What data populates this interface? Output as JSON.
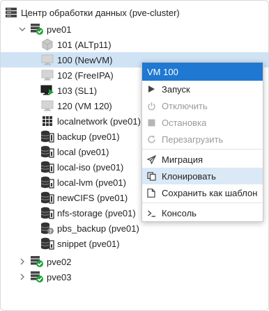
{
  "tree": {
    "datacenter": "Центр обработки данных (pve-cluster)",
    "node1": "pve01",
    "vms": [
      {
        "label": "101 (ALTp11)"
      },
      {
        "label": "100 (NewVM)"
      },
      {
        "label": "102 (FreeIPA)"
      },
      {
        "label": "103 (SL1)"
      },
      {
        "label": "120 (VM 120)"
      }
    ],
    "network": "localnetwork (pve01)",
    "storages": [
      {
        "label": "backup (pve01)"
      },
      {
        "label": "local (pve01)"
      },
      {
        "label": "local-iso (pve01)"
      },
      {
        "label": "local-lvm (pve01)"
      },
      {
        "label": "newCIFS (pve01)"
      },
      {
        "label": "nfs-storage (pve01)"
      },
      {
        "label": "pbs_backup (pve01)"
      },
      {
        "label": "snippet (pve01)"
      }
    ],
    "node2": "pve02",
    "node3": "pve03"
  },
  "menu": {
    "title": "VM 100",
    "items": [
      {
        "label": "Запуск"
      },
      {
        "label": "Отключить"
      },
      {
        "label": "Остановка"
      },
      {
        "label": "Перезагрузить"
      },
      {
        "label": "Миграция"
      },
      {
        "label": "Клонировать"
      },
      {
        "label": "Сохранить как шаблон"
      },
      {
        "label": "Консоль"
      }
    ]
  },
  "colors": {
    "accent": "#1f78d1",
    "selection": "#cfe3f5",
    "hover": "#dbe9f7",
    "running": "#21a038"
  }
}
